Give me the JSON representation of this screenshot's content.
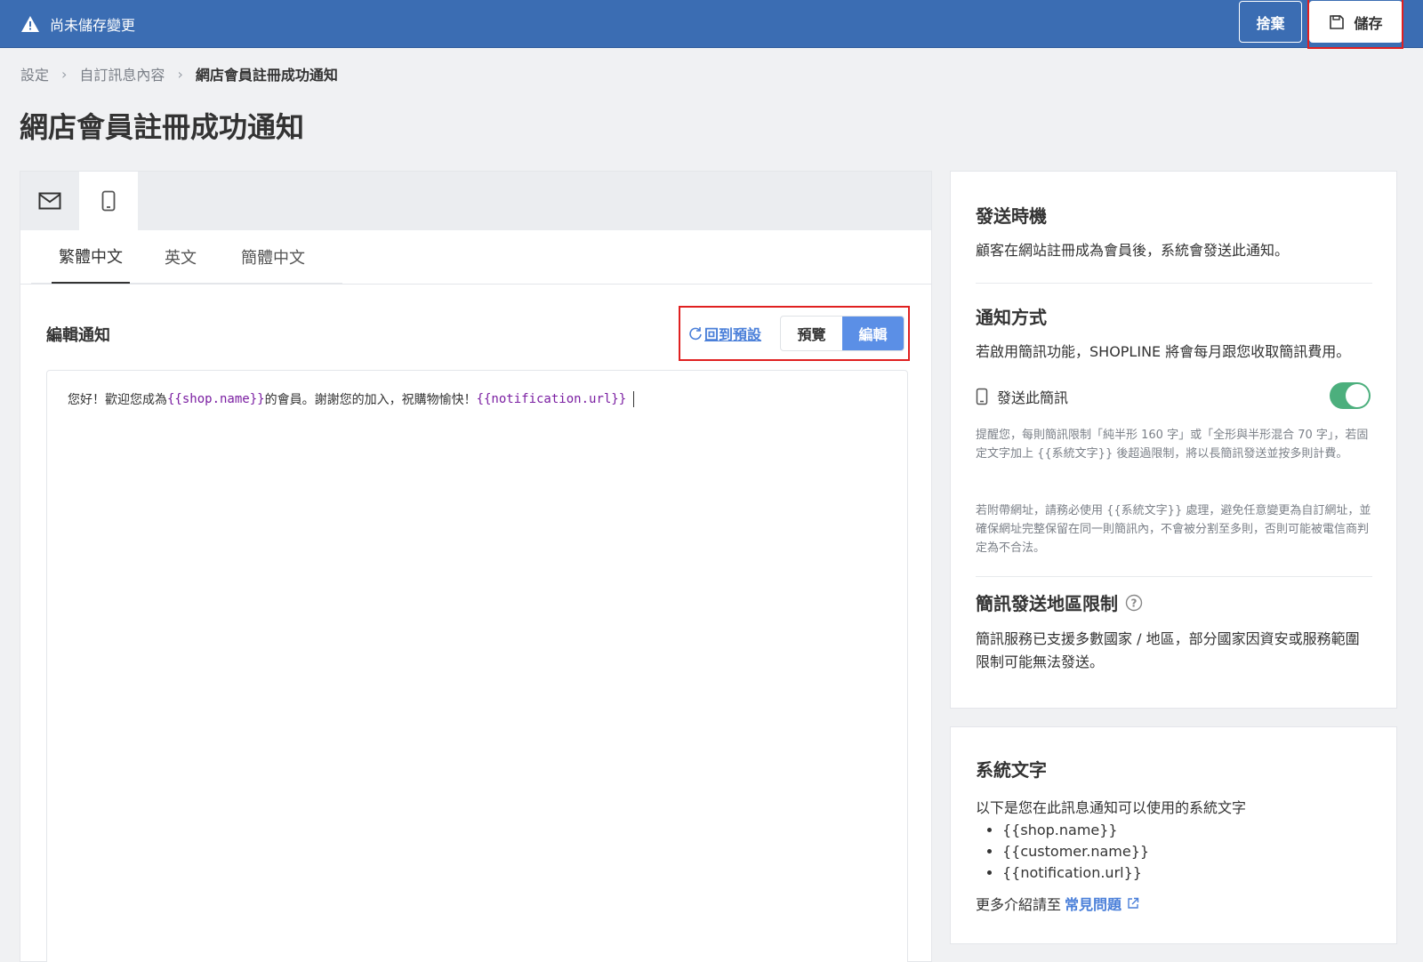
{
  "topbar": {
    "unsaved_label": "尚未儲存變更",
    "discard_label": "捨棄",
    "save_label": "儲存"
  },
  "breadcrumb": {
    "items": [
      "設定",
      "自訂訊息內容"
    ],
    "current": "網店會員註冊成功通知"
  },
  "page_title": "網店會員註冊成功通知",
  "channels": [
    "email-icon",
    "phone-icon"
  ],
  "languages": {
    "tabs": [
      "繁體中文",
      "英文",
      "簡體中文"
    ],
    "active": "繁體中文"
  },
  "editor": {
    "label": "編輯通知",
    "reset_label": "回到預設",
    "preview_label": "預覽",
    "edit_label": "編輯",
    "content": {
      "p1": "您好！歡迎您成為",
      "v1": "{{shop.name}}",
      "p2": "的會員。謝謝您的加入，祝購物愉快！",
      "v2": "{{notification.url}}"
    }
  },
  "sidebar": {
    "timing": {
      "title": "發送時機",
      "text": "顧客在網站註冊成為會員後，系統會發送此通知。"
    },
    "method": {
      "title": "通知方式",
      "text": "若啟用簡訊功能，SHOPLINE 將會每月跟您收取簡訊費用。",
      "sms_label": "發送此簡訊",
      "sms_enabled": true,
      "note1": "提醒您，每則簡訊限制「純半形 160 字」或「全形與半形混合 70 字」，若固定文字加上 {{系統文字}} 後超過限制，將以長簡訊發送並按多則計費。",
      "note2": "若附帶網址，請務必使用 {{系統文字}} 處理，避免任意變更為自訂網址，並確保網址完整保留在同一則簡訊內，不會被分割至多則，否則可能被電信商判定為不合法。"
    },
    "region": {
      "title": "簡訊發送地區限制",
      "text": "簡訊服務已支援多數國家 / 地區，部分國家因資安或服務範圍限制可能無法發送。"
    },
    "system_text": {
      "title": "系統文字",
      "intro": "以下是您在此訊息通知可以使用的系統文字",
      "vars": [
        "{{shop.name}}",
        "{{customer.name}}",
        "{{notification.url}}"
      ],
      "more_prefix": "更多介紹請至",
      "faq_label": "常見問題"
    }
  },
  "colors": {
    "topbar": "#3b6db3",
    "accent": "#5b8fe6",
    "link": "#4a7fd9",
    "toggle_on": "#4caf7d",
    "variable": "#7b1fa2",
    "highlight": "#e02020"
  }
}
